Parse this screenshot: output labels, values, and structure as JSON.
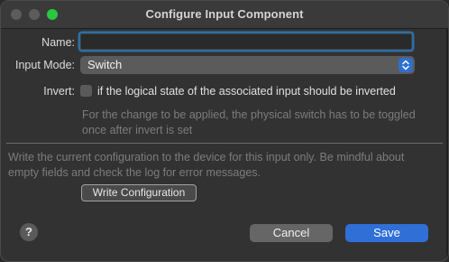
{
  "window": {
    "title": "Configure Input Component"
  },
  "form": {
    "name_label": "Name:",
    "name_value": "",
    "input_mode_label": "Input Mode:",
    "input_mode_value": "Switch",
    "invert_label": "Invert:",
    "invert_checked": false,
    "invert_text": "if the logical state of the associated input should be inverted",
    "invert_hint": "For the change to be applied, the physical switch has to be toggled once after invert is set"
  },
  "write_section": {
    "info": "Write the current configuration to the device for this input only. Be mindful about empty fields and check the log for error messages.",
    "button_label": "Write Configuration"
  },
  "footer": {
    "help_label": "?",
    "cancel_label": "Cancel",
    "save_label": "Save"
  },
  "colors": {
    "accent": "#2f6fd6",
    "focus_ring": "#2e6ea4",
    "zoom_button": "#28c840"
  },
  "icons": [
    "close-icon",
    "minimize-icon",
    "zoom-icon",
    "chevron-updown-icon",
    "help-icon"
  ]
}
